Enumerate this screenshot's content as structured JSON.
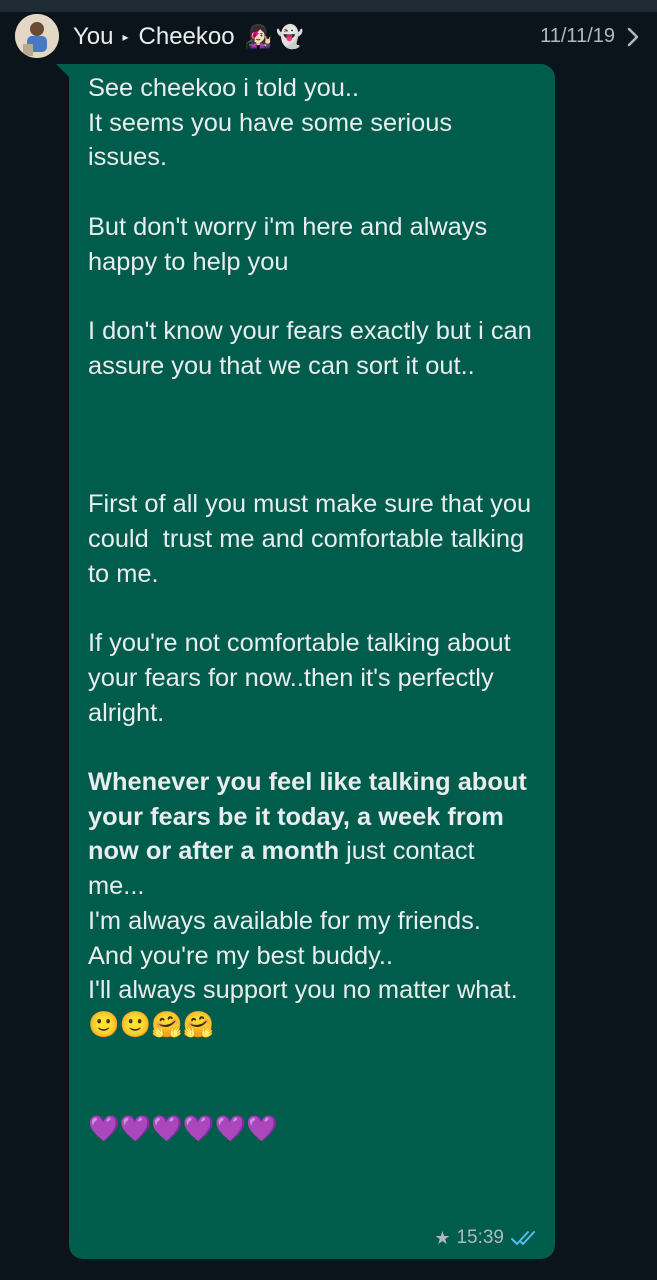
{
  "header": {
    "sender": "You",
    "arrow": "▸",
    "recipient": "Cheekoo",
    "recipient_emojis": [
      "👩🏻‍🎤",
      "👻"
    ],
    "date": "11/11/19",
    "chevron": "›"
  },
  "message": {
    "p1_line1": "See cheekoo i told you..",
    "p1_line2": "It seems you have some serious issues.",
    "p2": "But don't worry i'm here and always happy to help you",
    "p3": "I don't know your fears exactly but i can assure you that we can sort it out..",
    "p4": "First of all you must make sure that you could  trust me and comfortable talking to me.",
    "p5": "If you're not comfortable talking about your fears for now..then it's perfectly alright.",
    "p6_bold": "Whenever you feel like talking about your fears be it today, a week from now or after a month",
    "p6_rest": " just contact me...",
    "p7": "I'm always available for my friends.",
    "p8": "And you're my best buddy..",
    "p9": "I'll always support you no matter what.",
    "emoji_line1": "🙂🙂🤗🤗",
    "emoji_line2": "💜💜💜💜💜💜",
    "starred_icon": "star-icon",
    "time": "15:39",
    "status_icon": "double-check-icon",
    "status_color": "#53bdeb"
  },
  "colors": {
    "background": "#0b141a",
    "bubble": "#005c4b",
    "text": "#e9edef",
    "meta": "#aebac1"
  }
}
